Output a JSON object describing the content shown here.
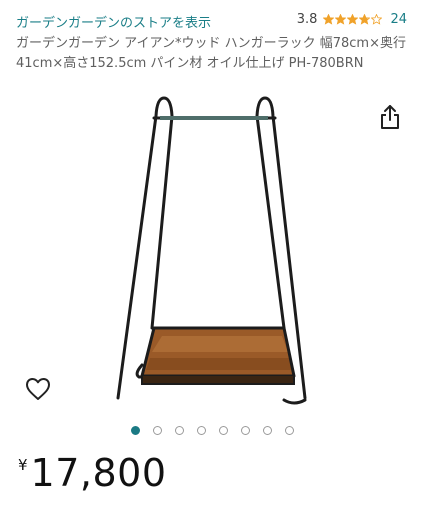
{
  "store": {
    "link_text": "ガーデンガーデンのストアを表示"
  },
  "rating": {
    "value": "3.8",
    "stars": 3.8,
    "max_stars": 5,
    "count": "24",
    "star_color": "#f0a22a"
  },
  "product": {
    "title": "ガーデンガーデン アイアン*ウッド ハンガーラック 幅78cm×奥行41cm×高さ152.5cm パイン材 オイル仕上げ PH-780BRN"
  },
  "icons": {
    "share": "share-icon",
    "wishlist": "heart-outline-icon"
  },
  "carousel": {
    "total": 8,
    "active_index": 0,
    "active_color": "#1b7a84"
  },
  "price": {
    "symbol": "¥",
    "value": "17,800"
  }
}
